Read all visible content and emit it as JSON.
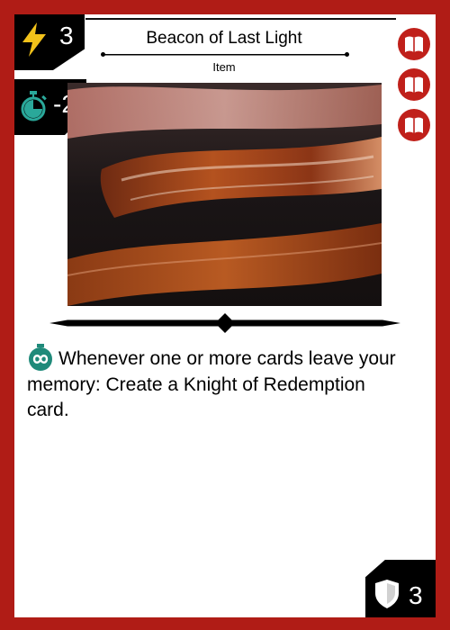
{
  "card": {
    "name": "Beacon of Last Light",
    "type_line": "Item",
    "cost": "3",
    "speed": "-2",
    "defense": "3",
    "rules_text": "Whenever one or more cards leave your memory: Create a Knight of Redemption card.",
    "rules_icon": "infinity-icon",
    "art_subject": "bacon-strips-frying"
  },
  "icons": {
    "cost": "lightning-bolt-icon",
    "speed": "stopwatch-icon",
    "defense": "shield-icon",
    "side": [
      "book-icon",
      "book-icon",
      "book-icon"
    ]
  },
  "colors": {
    "frame": "#b01c16",
    "bolt": "#f2c21a",
    "speed": "#2aa89a",
    "rules_icon": "#1f8a7a",
    "book_badge": "#c0201a"
  }
}
